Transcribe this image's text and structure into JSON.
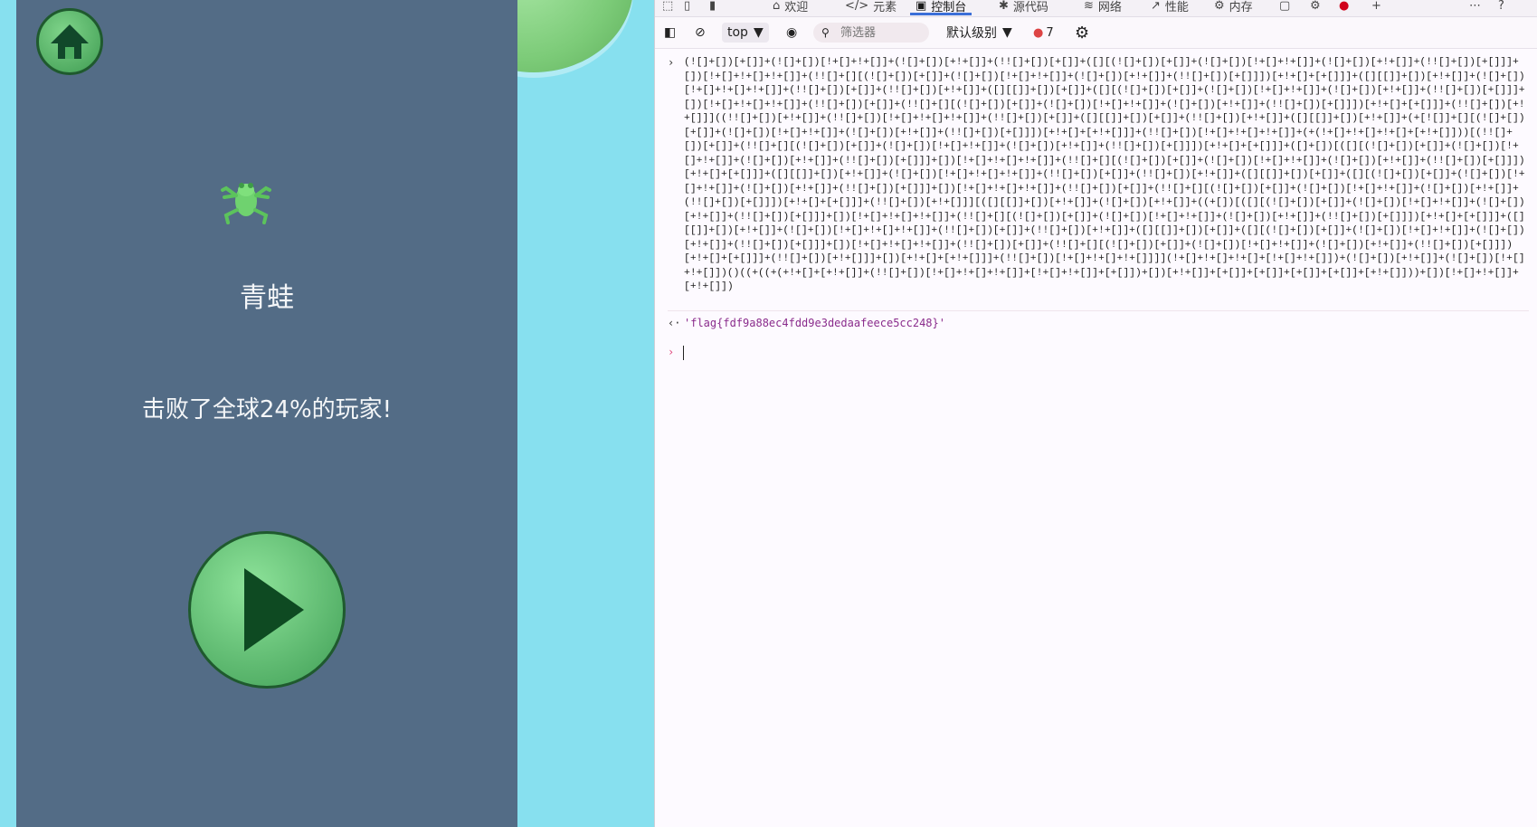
{
  "game": {
    "character_name": "青蛙",
    "score_text": "击败了全球24%的玩家!",
    "icons": {
      "home": "home-icon",
      "play": "play-icon",
      "frog": "frog-icon"
    }
  },
  "devtools": {
    "tabs": [
      {
        "label": "欢迎",
        "icon": "home-icon"
      },
      {
        "label": "元素",
        "icon": "code-icon"
      },
      {
        "label": "控制台",
        "icon": "console-icon",
        "active": true
      },
      {
        "label": "源代码",
        "icon": "bug-icon"
      },
      {
        "label": "网络",
        "icon": "wifi-icon"
      },
      {
        "label": "性能",
        "icon": "performance-icon"
      },
      {
        "label": "内存",
        "icon": "gear-icon"
      }
    ],
    "toolbar": {
      "context": "top",
      "filter_placeholder": "筛选器",
      "level": "默认级别",
      "issue_count": "7"
    },
    "console": {
      "input": "(![]+[])[+[]]+(![]+[])[!+[]+!+[]]+(![]+[])[+!+[]]+(!![]+[])[+[]]+([][(![]+[])[+[]]+(![]+[])[!+[]+!+[]]+(![]+[])[+!+[]]+(!![]+[])[+[]]]+[])[!+[]+!+[]+!+[]]+(!![]+[][(![]+[])[+[]]+(![]+[])[!+[]+!+[]]+(![]+[])[+!+[]]+(!![]+[])[+[]]])[+!+[]+[+[]]]+([][[]]+[])[+!+[]]+(![]+[])[!+[]+!+[]+!+[]]+(!![]+[])[+[]]+(!![]+[])[+!+[]]+([][[]]+[])[+[]]+([][(![]+[])[+[]]+(![]+[])[!+[]+!+[]]+(![]+[])[+!+[]]+(!![]+[])[+[]]]+[])[!+[]+!+[]+!+[]]+(!![]+[])[+[]]+(!![]+[][(![]+[])[+[]]+(![]+[])[!+[]+!+[]]+(![]+[])[+!+[]]+(!![]+[])[+[]]])[+!+[]+[+[]]]+(!![]+[])[+!+[]]]((!![]+[])[+!+[]]+(!![]+[])[!+[]+!+[]+!+[]]+(!![]+[])[+[]]+([][[]]+[])[+[]]+(!![]+[])[+!+[]]+([][[]]+[])[+!+[]]+(+[![]]+[][(![]+[])[+[]]+(![]+[])[!+[]+!+[]]+(![]+[])[+!+[]]+(!![]+[])[+[]]])[+!+[]+[+!+[]]]+(!![]+[])[!+[]+!+[]+!+[]]+(+(!+[]+!+[]+!+[]+[+!+[]]))[(!![]+[])[+[]]+(!![]+[][(![]+[])[+[]]+(![]+[])[!+[]+!+[]]+(![]+[])[+!+[]]+(!![]+[])[+[]]])[+!+[]+[+[]]]+([]+[])[([][(![]+[])[+[]]+(![]+[])[!+[]+!+[]]+(![]+[])[+!+[]]+(!![]+[])[+[]]]+[])[!+[]+!+[]+!+[]]+(!![]+[][(![]+[])[+[]]+(![]+[])[!+[]+!+[]]+(![]+[])[+!+[]]+(!![]+[])[+[]]])[+!+[]+[+[]]]+([][[]]+[])[+!+[]]+(![]+[])[!+[]+!+[]+!+[]]+(!![]+[])[+[]]+(!![]+[])[+!+[]]+([][[]]+[])[+[]]+([][(![]+[])[+[]]+(![]+[])[!+[]+!+[]]+(![]+[])[+!+[]]+(!![]+[])[+[]]]+[])[!+[]+!+[]+!+[]]+(!![]+[])[+[]]+(!![]+[][(![]+[])[+[]]+(![]+[])[!+[]+!+[]]+(![]+[])[+!+[]]+(!![]+[])[+[]]])[+!+[]+[+[]]]+(!![]+[])[+!+[]]][([][[]]+[])[+!+[]]+(![]+[])[+!+[]]+((+[])[([][(![]+[])[+[]]+(![]+[])[!+[]+!+[]]+(![]+[])[+!+[]]+(!![]+[])[+[]]]+[])[!+[]+!+[]+!+[]]+(!![]+[][(![]+[])[+[]]+(![]+[])[!+[]+!+[]]+(![]+[])[+!+[]]+(!![]+[])[+[]]])[+!+[]+[+[]]]+([][[]]+[])[+!+[]]+(![]+[])[!+[]+!+[]+!+[]]+(!![]+[])[+[]]+(!![]+[])[+!+[]]+([][[]]+[])[+[]]+([][(![]+[])[+[]]+(![]+[])[!+[]+!+[]]+(![]+[])[+!+[]]+(!![]+[])[+[]]]+[])[!+[]+!+[]+!+[]]+(!![]+[])[+[]]+(!![]+[][(![]+[])[+[]]+(![]+[])[!+[]+!+[]]+(![]+[])[+!+[]]+(!![]+[])[+[]]])[+!+[]+[+[]]]+(!![]+[])[+!+[]]]+[])[+!+[]+[+!+[]]]+(!![]+[])[!+[]+!+[]+!+[]]]](!+[]+!+[]+!+[]+[!+[]+!+[]])+(![]+[])[+!+[]]+(![]+[])[!+[]+!+[]])()((+((+(+!+[]+[+!+[]]+(!![]+[])[!+[]+!+[]+!+[]]+[!+[]+!+[]]+[+[]])+[])[+!+[]]+[+[]]+[+[]]+[+[]]+[+[]]+[+!+[]]))+[])[!+[]+!+[]]+[+!+[]])",
      "output": "'flag{fdf9a88ec4fdd9e3dedaafeece5cc248}'"
    }
  },
  "colors": {
    "sky": "#87e0ef",
    "panel": "#536c86",
    "accent_tab": "#3b6fd8",
    "output_string": "#8a2c8c"
  }
}
